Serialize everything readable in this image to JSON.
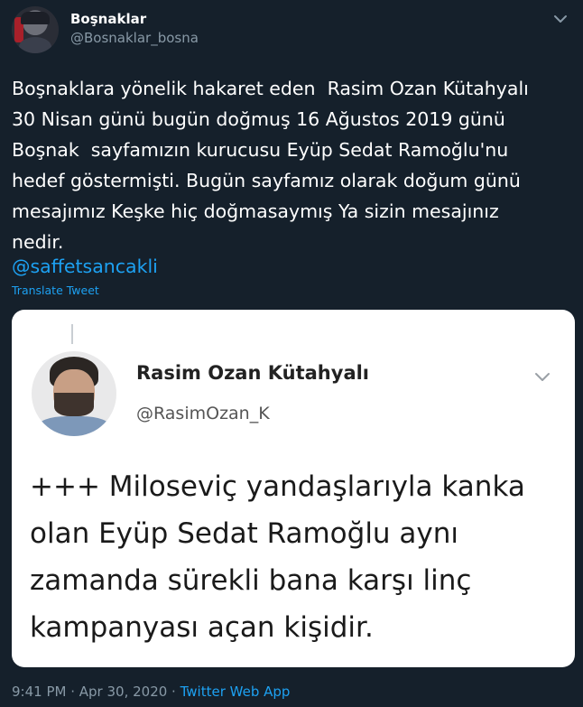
{
  "author": {
    "display_name": "Boşnaklar",
    "handle": "@Bosnaklar_bosna"
  },
  "tweet": {
    "text": "Boşnaklara yönelik hakaret eden  Rasim Ozan Kütahyalı\n30 Nisan günü bugün doğmuş 16 Ağustos 2019 günü\nBoşnak  sayfamızın kurucusu Eyüp Sedat Ramoğlu'nu\nhedef göstermişti. Bugün sayfamız olarak doğum günü\nmesajımız Keşke hiç doğmasaymış Ya sizin mesajınız\nnedir.",
    "mention": "@saffetsancakli",
    "translate_label": "Translate Tweet"
  },
  "media": {
    "name": "Rasim Ozan Kütahyalı",
    "handle": "@RasimOzan_K",
    "text": "+++ Miloseviç yandaşlarıyla kanka\nolan Eyüp Sedat Ramoğlu aynı\nzamanda sürekli bana karşı linç\nkampanyası açan kişidir."
  },
  "meta": {
    "time": "9:41 PM",
    "separator1": " · ",
    "date": "Apr 30, 2020",
    "separator2": " · ",
    "source": "Twitter Web App"
  },
  "icons": {
    "header_chevron": "chevron-down-icon",
    "media_chevron": "chevron-down-icon"
  },
  "colors": {
    "background": "#15202b",
    "accent": "#1da1f2",
    "secondary_text": "#8899a6"
  }
}
